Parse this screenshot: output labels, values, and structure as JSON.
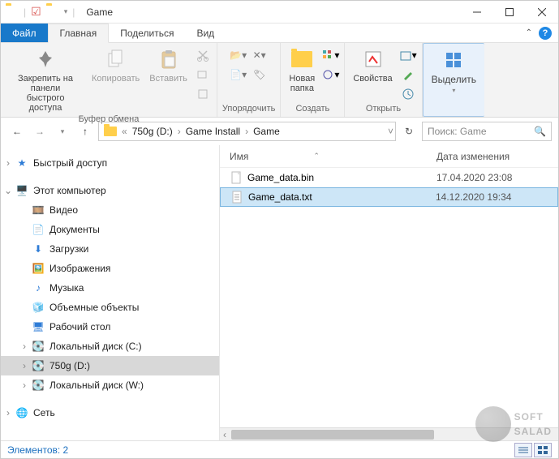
{
  "window": {
    "title": "Game"
  },
  "tabs": {
    "file": "Файл",
    "home": "Главная",
    "share": "Поделиться",
    "view": "Вид"
  },
  "ribbon": {
    "clipboard": {
      "pin": "Закрепить на панели\nбыстрого доступа",
      "copy": "Копировать",
      "paste": "Вставить",
      "label": "Буфер обмена"
    },
    "organize": {
      "label": "Упорядочить"
    },
    "new": {
      "newfolder": "Новая\nпапка",
      "label": "Создать"
    },
    "open": {
      "properties": "Свойства",
      "label": "Открыть"
    },
    "select": {
      "select": "Выделить"
    }
  },
  "breadcrumbs": [
    "750g (D:)",
    "Game Install",
    "Game"
  ],
  "search": {
    "placeholder": "Поиск: Game"
  },
  "tree": {
    "quick": "Быстрый доступ",
    "pc": "Этот компьютер",
    "children": [
      "Видео",
      "Документы",
      "Загрузки",
      "Изображения",
      "Музыка",
      "Объемные объекты",
      "Рабочий стол",
      "Локальный диск (C:)",
      "750g (D:)",
      "Локальный диск (W:)"
    ],
    "network": "Сеть"
  },
  "columns": {
    "name": "Имя",
    "date": "Дата изменения"
  },
  "files": [
    {
      "name": "Game_data.bin",
      "date": "17.04.2020 23:08",
      "selected": false
    },
    {
      "name": "Game_data.txt",
      "date": "14.12.2020 19:34",
      "selected": true
    }
  ],
  "status": {
    "count_label": "Элементов: 2"
  },
  "watermark": {
    "line1": "SOFT",
    "line2": "SALAD"
  }
}
